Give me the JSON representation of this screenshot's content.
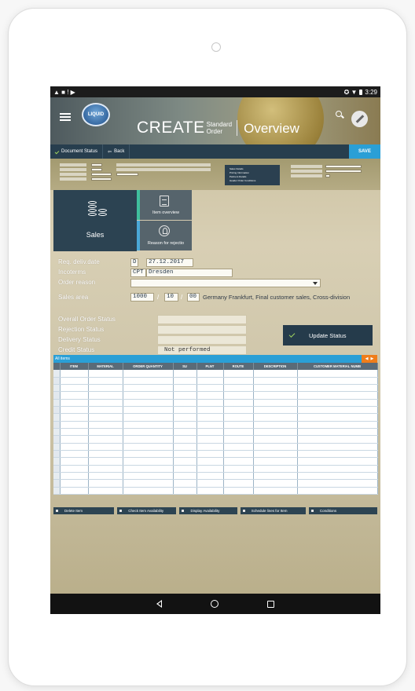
{
  "statusbar": {
    "time": "3:29",
    "left_icons": "▲ ■ ! ▶",
    "right_icons": "✪ ▼"
  },
  "header": {
    "create": "CREATE",
    "doc_type_line1": "Standard",
    "doc_type_line2": "Order",
    "view": "Overview",
    "logo_text": "LIQUID"
  },
  "toolbar": {
    "document_status": "Document Status",
    "back": "Back",
    "save": "SAVE"
  },
  "header_info": {
    "nav_links": [
      "Sales Details",
      "Pricing Information",
      "Partners Details",
      "Header Order Conditions"
    ]
  },
  "tiles": {
    "sales": "Sales",
    "item_overview": "Item overview",
    "reason_for_rejection": "Reason for rejectio"
  },
  "form": {
    "req_deliv_date_label": "Req. deliv.date",
    "req_deliv_date_prefix": "D",
    "req_deliv_date": "27.12.2017",
    "incoterms_label": "Incoterms",
    "incoterms_code": "CPT",
    "incoterms_place": "Dresden",
    "order_reason_label": "Order reason",
    "order_reason": "",
    "sales_area_label": "Sales area",
    "sales_org": "1000",
    "distr_channel": "10",
    "division": "00",
    "slash": "/",
    "sales_area_desc": "Germany Frankfurt, Final customer sales, Cross-division"
  },
  "status": {
    "overall_label": "Overall Order Status",
    "overall_value": "",
    "rejection_label": "Rejection Status",
    "rejection_value": "",
    "delivery_label": "Delivery Status",
    "delivery_value": "",
    "credit_label": "Credit Status",
    "credit_value": "Not performed",
    "update_button": "Update Status"
  },
  "items_table": {
    "title": "All items",
    "columns": [
      "ITEM",
      "MATERIAL",
      "ORDER QUANTITY",
      "SU",
      "PLNT",
      "ROUTE",
      "DESCRIPTION",
      "CUSTOMER MATERIAL NUMB"
    ],
    "rows": []
  },
  "actions": {
    "delete_item": "Delete Item",
    "check_item_availability": "Check Item Availability",
    "display_availability": "Display Availability",
    "schedule_lines": "Schedule lines for Item",
    "conditions": "Conditions"
  },
  "colors": {
    "accent": "#2a9fd6",
    "dark_panel": "#273e4e",
    "orange": "#ef7d1a",
    "check_green": "#9ed15f"
  }
}
